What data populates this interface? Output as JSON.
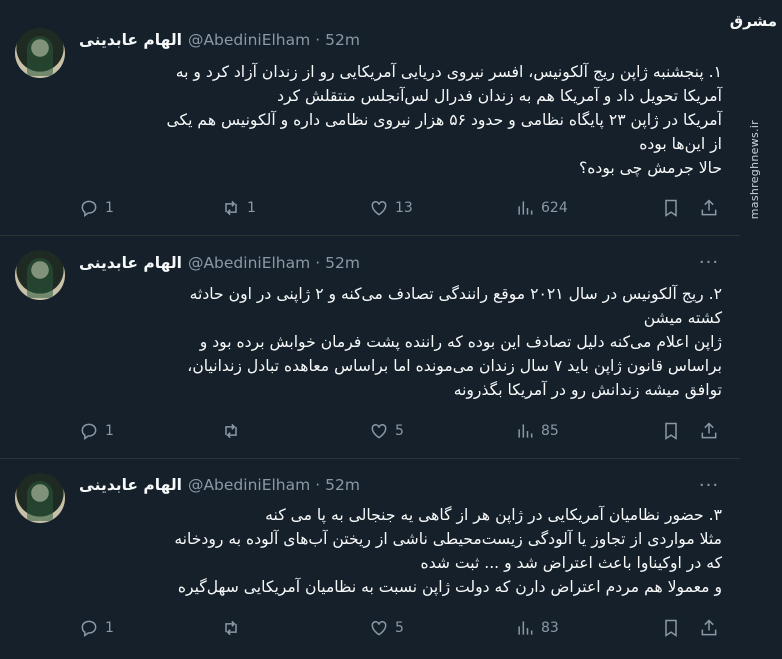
{
  "watermark": {
    "logo": "مشرق",
    "site": "mashreghnews.ir"
  },
  "tweets": [
    {
      "name": "الهام عابدینی",
      "handle": "@AbediniElham",
      "time": "52m",
      "lines": [
        "۱. پنجشنبه ژاپن ریج آلکونیس، افسر نیروی دریایی آمریکایی رو از زندان آزاد کرد و به",
        "آمریکا تحویل داد و آمریکا هم به زندان فدرال لس‌آنجلس منتقلش کرد",
        "آمریکا در ژاپن ۲۳ پایگاه نظامی و حدود ۵۶ هزار نیروی نظامی داره و آلکونیس هم یکی",
        "از این‌ها بوده",
        "حالا جرمش چی بوده؟"
      ],
      "replies": "1",
      "retweets": "1",
      "likes": "13",
      "views": "624"
    },
    {
      "name": "الهام عابدینی",
      "handle": "@AbediniElham",
      "time": "52m",
      "lines": [
        "۲. ریج آلکونیس در سال ۲۰۲۱ موقع رانندگی تصادف می‌کنه و ۲ ژاپنی در اون حادثه",
        "کشته میشن",
        "ژاپن اعلام می‌کنه دلیل تصادف این بوده که راننده پشت فرمان خوابش برده بود و",
        "براساس قانون ژاپن باید ۷ سال زندان می‌مونده اما براساس معاهده تبادل زندانیان،",
        "توافق میشه زندانش رو در آمریکا بگذرونه"
      ],
      "replies": "1",
      "retweets": "",
      "likes": "5",
      "views": "85"
    },
    {
      "name": "الهام عابدینی",
      "handle": "@AbediniElham",
      "time": "52m",
      "lines": [
        "۳. حضور نظامیان آمریکایی در ژاپن هر از گاهی یه جنجالی به پا می کنه",
        "مثلا مواردی از تجاوز یا آلودگی زیست‌محیطی ناشی از ریختن آب‌های آلوده به رودخانه",
        "که در اوکیناوا باعث اعتراض شد و ... ثبت شده",
        "و معمولا هم مردم اعتراض دارن که دولت ژاپن نسبت به نظامیان آمریکایی سهل‌گیره"
      ],
      "replies": "1",
      "retweets": "",
      "likes": "5",
      "views": "83"
    }
  ]
}
